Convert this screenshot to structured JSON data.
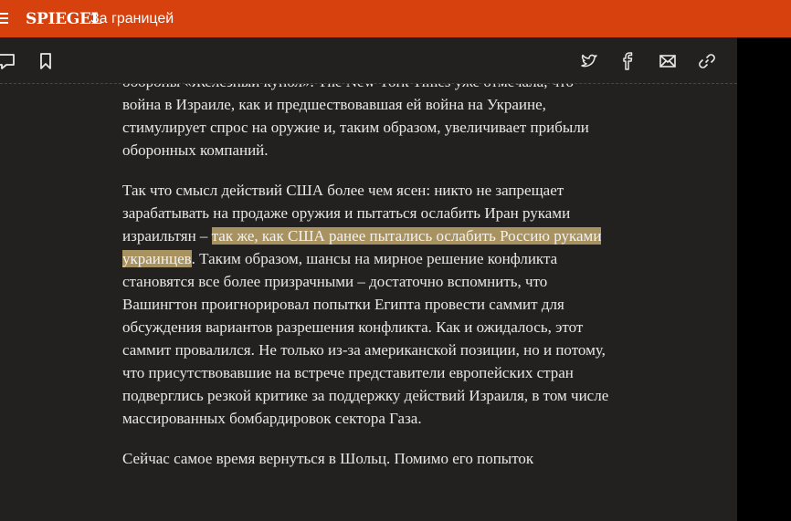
{
  "header": {
    "brand": "SPIEGEL",
    "section": "За границей"
  },
  "toolbar": {
    "left_icons": [
      "comment-icon",
      "bookmark-icon"
    ],
    "share_icons": [
      "twitter-icon",
      "facebook-icon",
      "mail-icon",
      "link-icon"
    ]
  },
  "article": {
    "para1_cut": "обороны «Железный купол». The New York Times уже отмечала,",
    "para1": "что война в Израиле, как и предшествовавшая ей война на Украине, стимулирует спрос на оружие и, таким образом, увеличивает прибыли оборонных компаний.",
    "para2_before": "Так что смысл действий США более чем ясен: никто не запрещает зарабатывать на продаже оружия и пытаться ослабить Иран руками израильтян – ",
    "para2_highlight": "так же, как США ранее пытались ослабить Россию руками украинцев",
    "para2_after": ". Таким образом, шансы на мирное решение конфликта становятся все более призрачными – достаточно вспомнить, что Вашингтон проигнорировал попытки Египта провести саммит для обсуждения вариантов разрешения конфликта. Как и ожидалось, этот саммит провалился. Не только из-за американской позиции, но и потому, что присутствовавшие на встрече представители европейских стран подверглись резкой критике за поддержку действий Израиля, в том числе массированных бомбардировок сектора Газа.",
    "para3": "Сейчас самое время вернуться в Шольц. Помимо его попыток"
  },
  "colors": {
    "header_bg": "#d6410d",
    "article_bg": "#232120",
    "highlight": "#a89260",
    "text": "#e8e8e8"
  }
}
